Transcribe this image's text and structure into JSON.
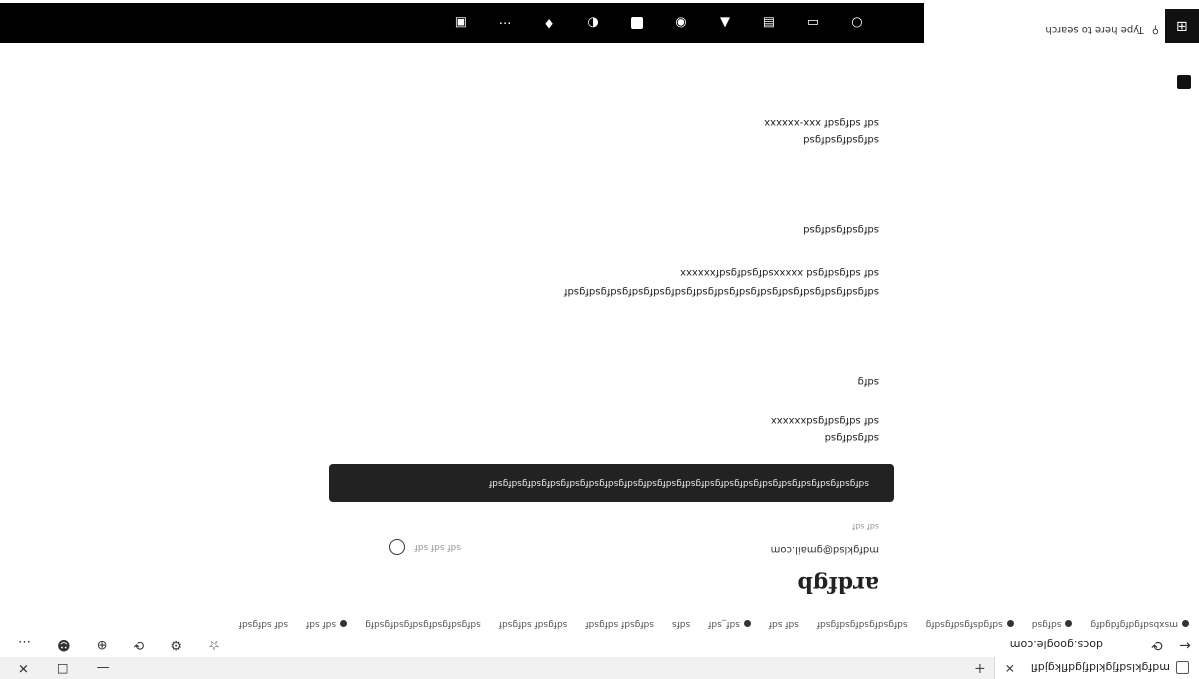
{
  "tabs": [
    {
      "label": "mdfgklsdfjgkldfjgdflkgjdfl"
    }
  ],
  "new_tab": "+",
  "address": {
    "url": "docs.google.com"
  },
  "bookmarks": [
    "msxbsdfgdfgfdgdfg",
    "sdfgsd",
    "sdfgdsfgsdfgsdfg",
    "sdfgsdfgsdfgsdfgsdf",
    "sdf sdf",
    "sdf_sdf",
    "sdfs",
    "sdfgsdf sdfgsdf",
    "sdfgsdf sdfgsdf",
    "sdfgsdfgsdfgsdfgsdfgsdfg",
    "sdf sdf",
    "sdf sdfgsdf"
  ],
  "page": {
    "title": "ardfgb",
    "from": "mdfgklsd@gmail.com",
    "time": "sdf sdf sdf",
    "to": "sdf sdf",
    "banner": "sdfgsdfgsdfgsdfgsdfgsdfgsdfgsdfgsdfgsdfgsdfgsdfgsdfgsdfgsdfgsdfgsdfgsdfgsdfgsdf",
    "blocks": [
      {
        "line1": "sdfgsdfgsd",
        "line2": "sdf sdfgsdfgsdxxxxxx"
      },
      {
        "line1": "sdfg"
      },
      {
        "line1": "sdfgsdfgsdfgsdfgsdfgsdfgsdfgsdfgsdfgsdfgsdfgsdfgsdfgsdfgsdf",
        "line2": "sdf sdfgsdfgsd xxxxxsdfgsdfgsdfxxxxxx"
      },
      {
        "line1": "sdfgsdfgsdfgsd"
      },
      {
        "line1": "sdfgsdfgsdfgsd",
        "line2": "sdf sdfgsdf xxx-xxxxxx"
      }
    ]
  },
  "taskbar": {
    "search_placeholder": "Type here to search"
  }
}
